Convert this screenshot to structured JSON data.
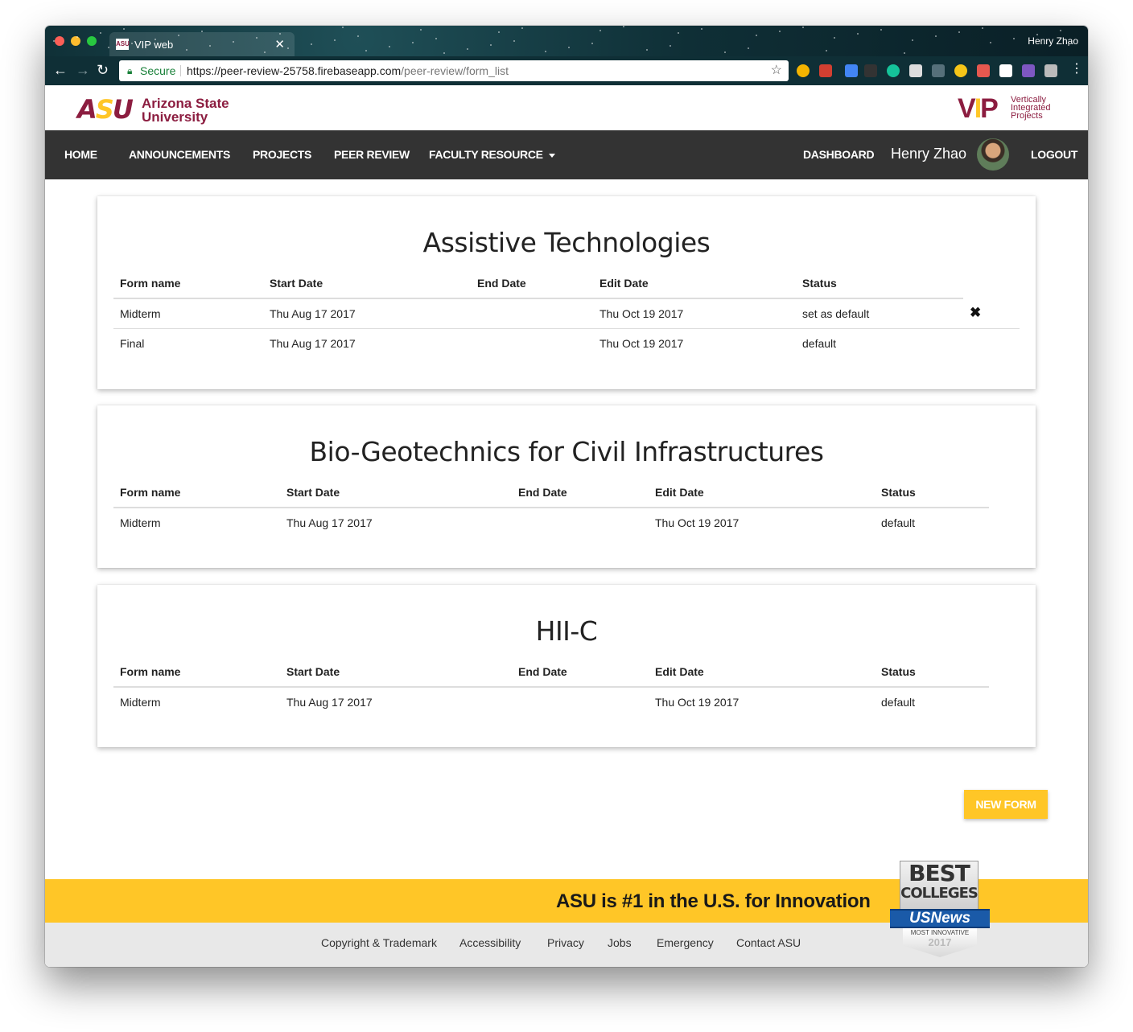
{
  "browser": {
    "tab_title": "VIP web",
    "tab_favicon_text": "ASU",
    "profile_name": "Henry Zhao",
    "secure_label": "Secure",
    "url_base": "https://peer-review-25758.firebaseapp.com",
    "url_path": "/peer-review/form_list"
  },
  "header": {
    "asu_mark": "ASU",
    "asu_name_line1": "Arizona State",
    "asu_name_line2": "University",
    "vip_mark": "VIP",
    "vip_text_line1": "Vertically",
    "vip_text_line2": "Integrated",
    "vip_text_line3": "Projects"
  },
  "nav": {
    "home": "HOME",
    "announcements": "ANNOUNCEMENTS",
    "projects": "PROJECTS",
    "peer_review": "PEER REVIEW",
    "faculty_resource": "FACULTY RESOURCE",
    "dashboard": "DASHBOARD",
    "user_name": "Henry Zhao",
    "logout": "LOGOUT"
  },
  "columns": {
    "form_name": "Form name",
    "start_date": "Start Date",
    "end_date": "End Date",
    "edit_date": "Edit Date",
    "status": "Status"
  },
  "projects": [
    {
      "title": "Assistive Technologies",
      "forms": [
        {
          "name": "Midterm",
          "start": "Thu Aug 17 2017",
          "end": "",
          "edit": "Thu Oct 19 2017",
          "status": "set as default"
        },
        {
          "name": "Final",
          "start": "Thu Aug 17 2017",
          "end": "",
          "edit": "Thu Oct 19 2017",
          "status": "default"
        }
      ]
    },
    {
      "title": "Bio-Geotechnics for Civil Infrastructures",
      "forms": [
        {
          "name": "Midterm",
          "start": "Thu Aug 17 2017",
          "end": "",
          "edit": "Thu Oct 19 2017",
          "status": "default"
        }
      ]
    },
    {
      "title": "HII-C",
      "forms": [
        {
          "name": "Midterm",
          "start": "Thu Aug 17 2017",
          "end": "",
          "edit": "Thu Oct 19 2017",
          "status": "default"
        }
      ]
    }
  ],
  "delete_icon": "✖",
  "new_form_label": "NEW FORM",
  "footer": {
    "innovation_text": "ASU is #1 in the U.S. for Innovation",
    "links": [
      "Copyright & Trademark",
      "Accessibility",
      "Privacy",
      "Jobs",
      "Emergency",
      "Contact ASU"
    ],
    "badge": {
      "line1": "BEST",
      "line2": "COLLEGES",
      "ribbon": "USNews",
      "line3": "MOST INNOVATIVE",
      "year": "2017"
    }
  },
  "colors": {
    "asu_maroon": "#8c1d40",
    "asu_gold": "#ffc627",
    "nav_bg": "#333333",
    "link_blue": "#2a6fb5"
  }
}
